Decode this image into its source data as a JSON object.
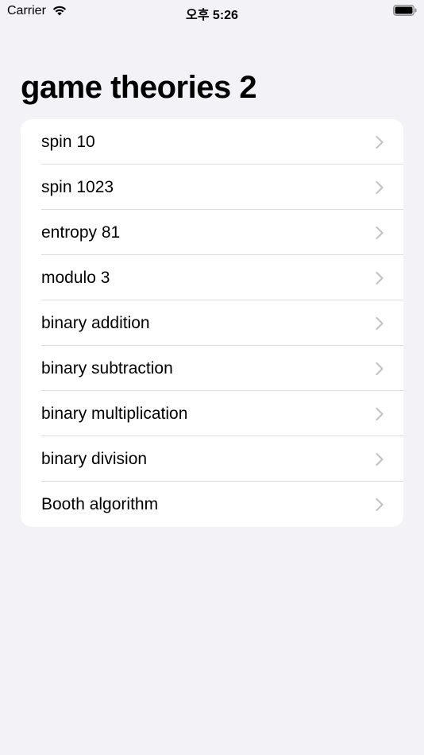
{
  "status_bar": {
    "carrier": "Carrier",
    "time": "오후 5:26"
  },
  "page": {
    "title": "game theories 2"
  },
  "list": {
    "items": [
      {
        "label": "spin 10"
      },
      {
        "label": "spin 1023"
      },
      {
        "label": "entropy 81"
      },
      {
        "label": "modulo 3"
      },
      {
        "label": "binary addition"
      },
      {
        "label": "binary subtraction"
      },
      {
        "label": "binary multiplication"
      },
      {
        "label": "binary division"
      },
      {
        "label": "Booth algorithm"
      }
    ]
  },
  "colors": {
    "background": "#f2f2f7",
    "card": "#ffffff",
    "separator": "#dcdce0",
    "chevron": "#c4c4c7"
  },
  "icons": {
    "wifi": "wifi-icon",
    "battery": "battery-icon",
    "chevron": "chevron-right-icon"
  }
}
